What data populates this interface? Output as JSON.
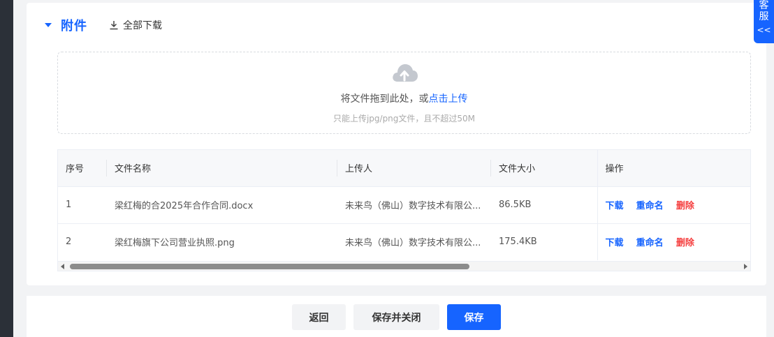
{
  "section": {
    "title": "附件",
    "download_all": "全部下载"
  },
  "upload": {
    "text_prefix": "将文件拖到此处，或",
    "text_link": "点击上传",
    "hint": "只能上传jpg/png文件，且不超过50M"
  },
  "table": {
    "headers": {
      "index": "序号",
      "name": "文件名称",
      "uploader": "上传人",
      "size": "文件大小",
      "actions": "操作"
    },
    "rows": [
      {
        "index": "1",
        "name": "梁红梅的合2025年合作合同.docx",
        "uploader": "未来鸟（佛山）数字技术有限公...",
        "size": "86.5KB"
      },
      {
        "index": "2",
        "name": "梁红梅旗下公司营业执照.png",
        "uploader": "未来鸟（佛山）数字技术有限公...",
        "size": "175.4KB"
      }
    ],
    "actions": {
      "download": "下载",
      "rename": "重命名",
      "delete": "删除"
    }
  },
  "footer": {
    "back": "返回",
    "save_close": "保存并关闭",
    "save": "保存"
  },
  "service_tab": {
    "line1": "客",
    "line2": "服",
    "chevron": "<<"
  },
  "colors": {
    "primary": "#1664ff",
    "danger": "#f53f3f"
  }
}
